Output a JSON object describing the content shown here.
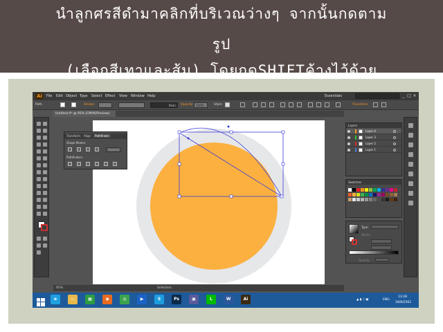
{
  "slide": {
    "title_line1": "นำลูกศรสีดำมาคลิกที่บริเวณว่างๆ จากนั้นกดตาม",
    "title_line2": "รูป",
    "title_line3": "(เลือกสีเทาและส้ม) โดยกดSHIFTค้างไว้ด้วย"
  },
  "app": {
    "logo": "Ai",
    "menu": [
      "File",
      "Edit",
      "Object",
      "Type",
      "Select",
      "Effect",
      "View",
      "Window",
      "Help"
    ],
    "workspace": "Essentials",
    "window_controls": [
      "_",
      "□",
      "×"
    ]
  },
  "control_bar": {
    "selection_label": "Path",
    "stroke_label": "Stroke:",
    "brush_value": "Basic",
    "opacity_label": "Opacity:",
    "opacity_value": "100%",
    "style_label": "Style:",
    "transform_label": "Transform"
  },
  "document_tab": "Untitled-4* @ 95% (CMYK/Preview)",
  "pathfinder_panel": {
    "tabs": [
      "Transform",
      "Align",
      "Pathfinder"
    ],
    "shape_modes_label": "Shape Modes:",
    "expand_label": "Expand",
    "pathfinders_label": "Pathfinders:"
  },
  "layers_panel": {
    "title": "Layers",
    "layers": [
      {
        "name": "Layer 4",
        "color": "#f7931e"
      },
      {
        "name": "Layer 3",
        "color": "#35c235"
      },
      {
        "name": "Layer 2",
        "color": "#d22f2f"
      },
      {
        "name": "Layer 1",
        "color": "#4a7bd8"
      }
    ]
  },
  "swatches_panel": {
    "title": "Swatches"
  },
  "color_panel": {
    "type_label": "Type:",
    "stroke_label": "Stroke:",
    "opacity_label": "Opacity:",
    "location_label": "Location:"
  },
  "status_bar": {
    "zoom": "95%",
    "tool": "Selection"
  },
  "artwork": {
    "outer_circle_color": "#e6e7e9",
    "inner_circle_color": "#fbb040",
    "selection_color": "#3b3bd8"
  },
  "taskbar": {
    "apps": [
      {
        "name": "ie",
        "label": "e",
        "color": "#1fa0e0"
      },
      {
        "name": "explorer",
        "label": "▭",
        "color": "#e8b94a"
      },
      {
        "name": "store",
        "label": "▦",
        "color": "#2d9c42"
      },
      {
        "name": "firefox",
        "label": "◉",
        "color": "#e86a1f"
      },
      {
        "name": "chrome",
        "label": "◎",
        "color": "#3ca34d"
      },
      {
        "name": "media",
        "label": "▶",
        "color": "#1c63c7"
      },
      {
        "name": "skype",
        "label": "S",
        "color": "#1d9cde"
      },
      {
        "name": "photoshop",
        "label": "Ps",
        "color": "#0b2a4a"
      },
      {
        "name": "app",
        "label": "▣",
        "color": "#5a5a9a"
      },
      {
        "name": "line",
        "label": "L",
        "color": "#00b900"
      },
      {
        "name": "word",
        "label": "W",
        "color": "#2b579a"
      },
      {
        "name": "illustrator",
        "label": "Ai",
        "color": "#3b2a12"
      }
    ],
    "language": "ENG",
    "time": "13:28",
    "date": "18/8/2562"
  }
}
